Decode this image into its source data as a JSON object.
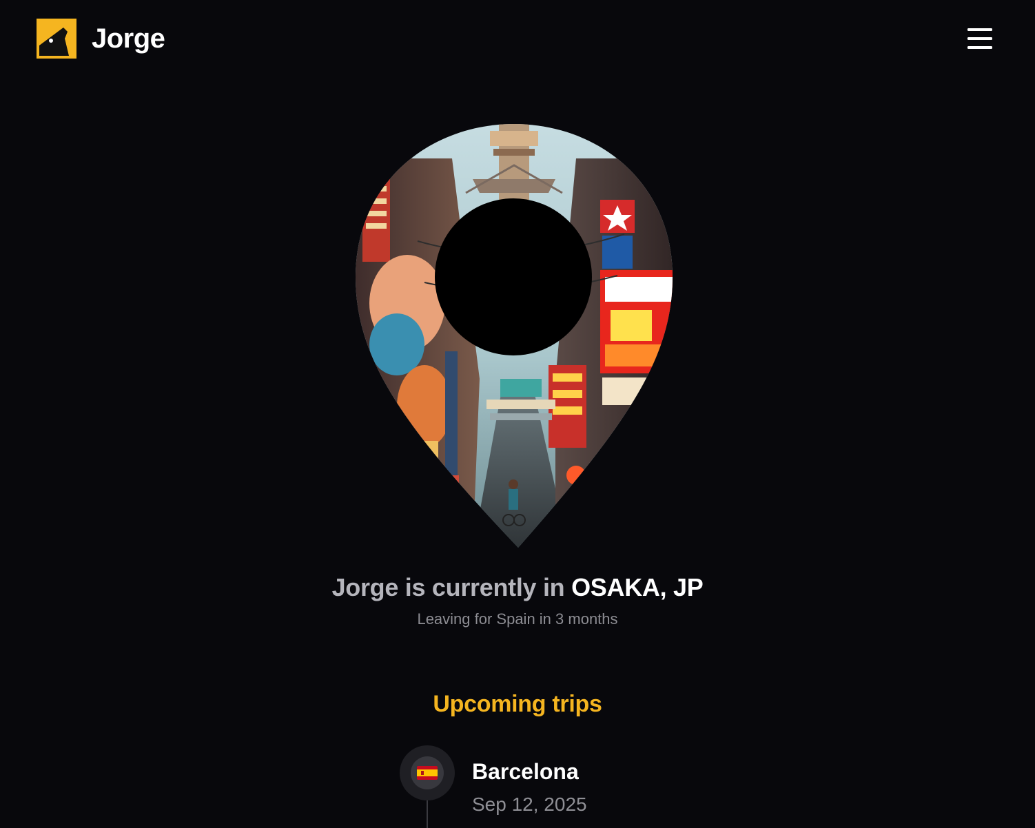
{
  "brand": {
    "name": "Jorge",
    "logo_icon": "bird-logo-icon",
    "accent_color": "#f5b520"
  },
  "header": {
    "menu_icon": "hamburger-menu-icon"
  },
  "hero": {
    "pin_icon": "location-pin-photo",
    "photo_subject": "Osaka street scene"
  },
  "status": {
    "prefix": "Jorge is currently in ",
    "location": "OSAKA, JP",
    "subtitle": "Leaving for Spain in 3 months"
  },
  "trips": {
    "heading": "Upcoming trips",
    "items": [
      {
        "city": "Barcelona",
        "date": "Sep 12, 2025",
        "flag_icon": "spain-flag-icon"
      }
    ]
  },
  "colors": {
    "background": "#08080c",
    "muted_text": "#8d8d93",
    "status_prefix": "#b5b5bc"
  }
}
